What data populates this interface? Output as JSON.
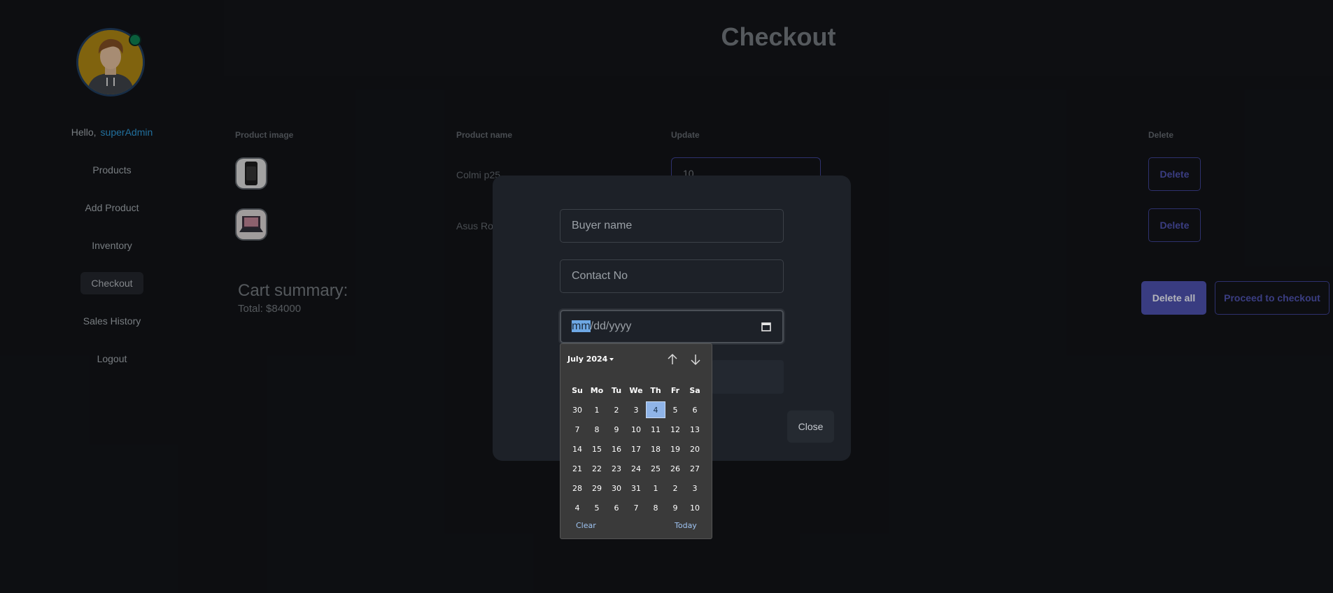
{
  "sidebar": {
    "hello": "Hello,",
    "username": "superAdmin",
    "nav": [
      "Products",
      "Add Product",
      "Inventory",
      "Checkout",
      "Sales History",
      "Logout"
    ]
  },
  "page": {
    "title": "Checkout"
  },
  "table": {
    "headers": [
      "Product image",
      "Product name",
      "Update",
      "Delete"
    ],
    "rows": [
      {
        "name": "Colmi p25",
        "qty": "10",
        "delete": "Delete"
      },
      {
        "name": "Asus Rog",
        "delete": "Delete"
      }
    ]
  },
  "cart": {
    "title": "Cart summary:",
    "total": "Total: $84000"
  },
  "actions": {
    "delete_all": "Delete all",
    "proceed": "Proceed to checkout"
  },
  "modal": {
    "buyer_placeholder": "Buyer name",
    "contact_placeholder": "Contact No",
    "date_mm": "mm",
    "date_rest": "/dd/yyyy",
    "close": "Close"
  },
  "datepicker": {
    "month_label": "July 2024",
    "weekdays": [
      "Su",
      "Mo",
      "Tu",
      "We",
      "Th",
      "Fr",
      "Sa"
    ],
    "weeks": [
      [
        "30",
        "1",
        "2",
        "3",
        "4",
        "5",
        "6"
      ],
      [
        "7",
        "8",
        "9",
        "10",
        "11",
        "12",
        "13"
      ],
      [
        "14",
        "15",
        "16",
        "17",
        "18",
        "19",
        "20"
      ],
      [
        "21",
        "22",
        "23",
        "24",
        "25",
        "26",
        "27"
      ],
      [
        "28",
        "29",
        "30",
        "31",
        "1",
        "2",
        "3"
      ],
      [
        "4",
        "5",
        "6",
        "7",
        "8",
        "9",
        "10"
      ]
    ],
    "selected": {
      "week": 0,
      "day": 4
    },
    "clear": "Clear",
    "today": "Today"
  },
  "colors": {
    "accent": "#4a4ea6",
    "link": "#2b8fc9",
    "selected_day": "#8fb4e8"
  }
}
